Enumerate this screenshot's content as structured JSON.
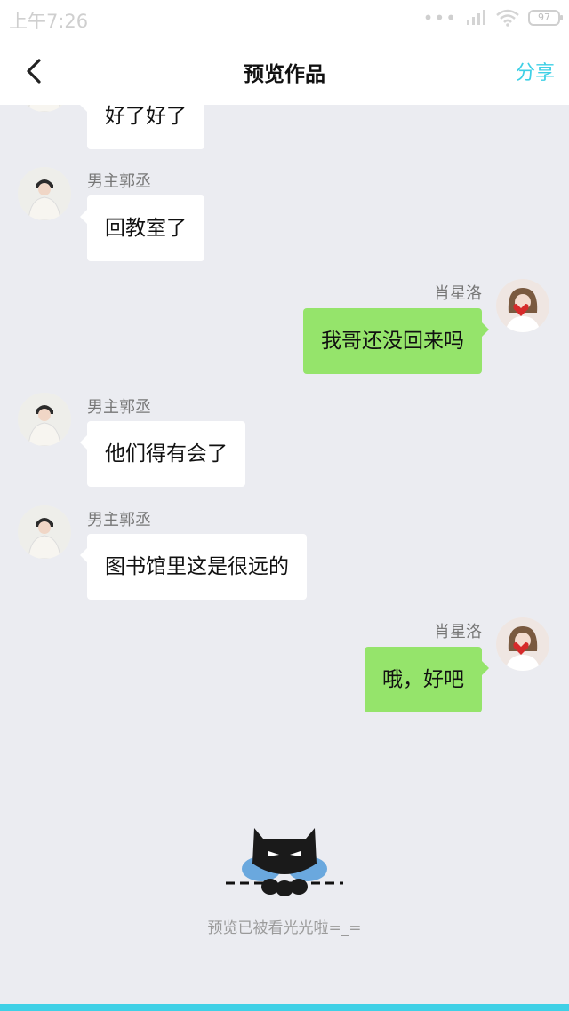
{
  "status_bar": {
    "time": "上午7:26",
    "signal_dots": "•••",
    "battery": "97"
  },
  "nav": {
    "title": "预览作品",
    "share": "分享"
  },
  "messages": [
    {
      "side": "left",
      "sender": "",
      "text": "好了好了"
    },
    {
      "side": "left",
      "sender": "男主郭丞",
      "text": "回教室了"
    },
    {
      "side": "right",
      "sender": "肖星洛",
      "text": "我哥还没回来吗"
    },
    {
      "side": "left",
      "sender": "男主郭丞",
      "text": "他们得有会了"
    },
    {
      "side": "left",
      "sender": "男主郭丞",
      "text": "图书馆里这是很远的"
    },
    {
      "side": "right",
      "sender": "肖星洛",
      "text": "哦，好吧"
    }
  ],
  "footer": {
    "end_text": "预览已被看光光啦=_="
  },
  "colors": {
    "accent": "#3fd0e6",
    "bubble_right": "#95e46b",
    "bubble_left": "#ffffff",
    "background": "#ebecf1"
  }
}
